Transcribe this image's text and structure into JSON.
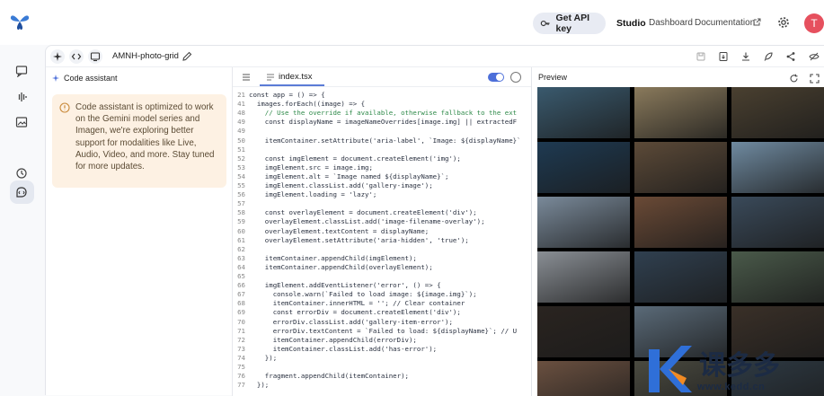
{
  "header": {
    "api_key_label": "Get API key",
    "nav": [
      "Studio",
      "Dashboard",
      "Documentation"
    ],
    "avatar_initial": "T",
    "colors": {
      "avatar": "#e6505e",
      "accent": "#4d6fd9"
    }
  },
  "rail": {
    "icons": [
      "chat-icon",
      "audio-wave-icon",
      "image-icon",
      "build-icon",
      "history-icon"
    ],
    "selected": "build-icon"
  },
  "toolbar": {
    "project_name": "AMNH-photo-grid",
    "right_icons": [
      "save-icon",
      "download-code-icon",
      "download-icon",
      "deploy-icon",
      "share-icon",
      "hide-icon"
    ]
  },
  "assistant": {
    "title": "Code assistant",
    "notice": "Code assistant is optimized to work on the Gemini model series and Imagen, we're exploring better support for modalities like Live, Audio, Video, and more. Stay tuned for more updates."
  },
  "editor": {
    "file_name": "index.tsx",
    "lines": [
      {
        "n": "21",
        "t": "const app = () => {"
      },
      {
        "n": "41",
        "t": "  images.forEach((image) => {"
      },
      {
        "n": "48",
        "t": "    // Use the override if available, otherwise fallback to the ext"
      },
      {
        "n": "49",
        "t": "    const displayName = imageNameOverrides[image.img] || extractedF"
      },
      {
        "n": "49",
        "t": ""
      },
      {
        "n": "50",
        "t": "    itemContainer.setAttribute('aria-label', `Image: ${displayName}`"
      },
      {
        "n": "51",
        "t": ""
      },
      {
        "n": "52",
        "t": "    const imgElement = document.createElement('img');"
      },
      {
        "n": "53",
        "t": "    imgElement.src = image.img;"
      },
      {
        "n": "54",
        "t": "    imgElement.alt = `Image named ${displayName}`;"
      },
      {
        "n": "55",
        "t": "    imgElement.classList.add('gallery-image');"
      },
      {
        "n": "56",
        "t": "    imgElement.loading = 'lazy';"
      },
      {
        "n": "57",
        "t": ""
      },
      {
        "n": "58",
        "t": "    const overlayElement = document.createElement('div');"
      },
      {
        "n": "59",
        "t": "    overlayElement.classList.add('image-filename-overlay');"
      },
      {
        "n": "60",
        "t": "    overlayElement.textContent = displayName;"
      },
      {
        "n": "61",
        "t": "    overlayElement.setAttribute('aria-hidden', 'true');"
      },
      {
        "n": "62",
        "t": ""
      },
      {
        "n": "63",
        "t": "    itemContainer.appendChild(imgElement);"
      },
      {
        "n": "64",
        "t": "    itemContainer.appendChild(overlayElement);"
      },
      {
        "n": "65",
        "t": ""
      },
      {
        "n": "66",
        "t": "    imgElement.addEventListener('error', () => {"
      },
      {
        "n": "67",
        "t": "      console.warn(`Failed to load image: ${image.img}`);"
      },
      {
        "n": "68",
        "t": "      itemContainer.innerHTML = ''; // Clear container"
      },
      {
        "n": "69",
        "t": "      const errorDiv = document.createElement('div');"
      },
      {
        "n": "70",
        "t": "      errorDiv.classList.add('gallery-item-error');"
      },
      {
        "n": "71",
        "t": "      errorDiv.textContent = `Failed to load: ${displayName}`; // U"
      },
      {
        "n": "72",
        "t": "      itemContainer.appendChild(errorDiv);"
      },
      {
        "n": "73",
        "t": "      itemContainer.classList.add('has-error');"
      },
      {
        "n": "74",
        "t": "    });"
      },
      {
        "n": "75",
        "t": ""
      },
      {
        "n": "76",
        "t": "    fragment.appendChild(itemContainer);"
      },
      {
        "n": "77",
        "t": "  });"
      }
    ]
  },
  "preview": {
    "title": "Preview",
    "tiles": [
      "#3a5a6e",
      "#8a7a5c",
      "#4a4030",
      "#1e3a52",
      "#5c4a38",
      "#6f8aa0",
      "#7a8a9a",
      "#6a4a36",
      "#3a4a5a",
      "#8a8f95",
      "#304050",
      "#4a5a4a",
      "#2a2420",
      "#5a6a78",
      "#3a3028",
      "#6a5040",
      "#4a4a40",
      "#2e3a44"
    ]
  },
  "watermark": {
    "text": "www.kedd.cn",
    "brand_chars": "课多多",
    "colors": {
      "k": "#2f6fd8",
      "orange": "#f08a24"
    }
  }
}
